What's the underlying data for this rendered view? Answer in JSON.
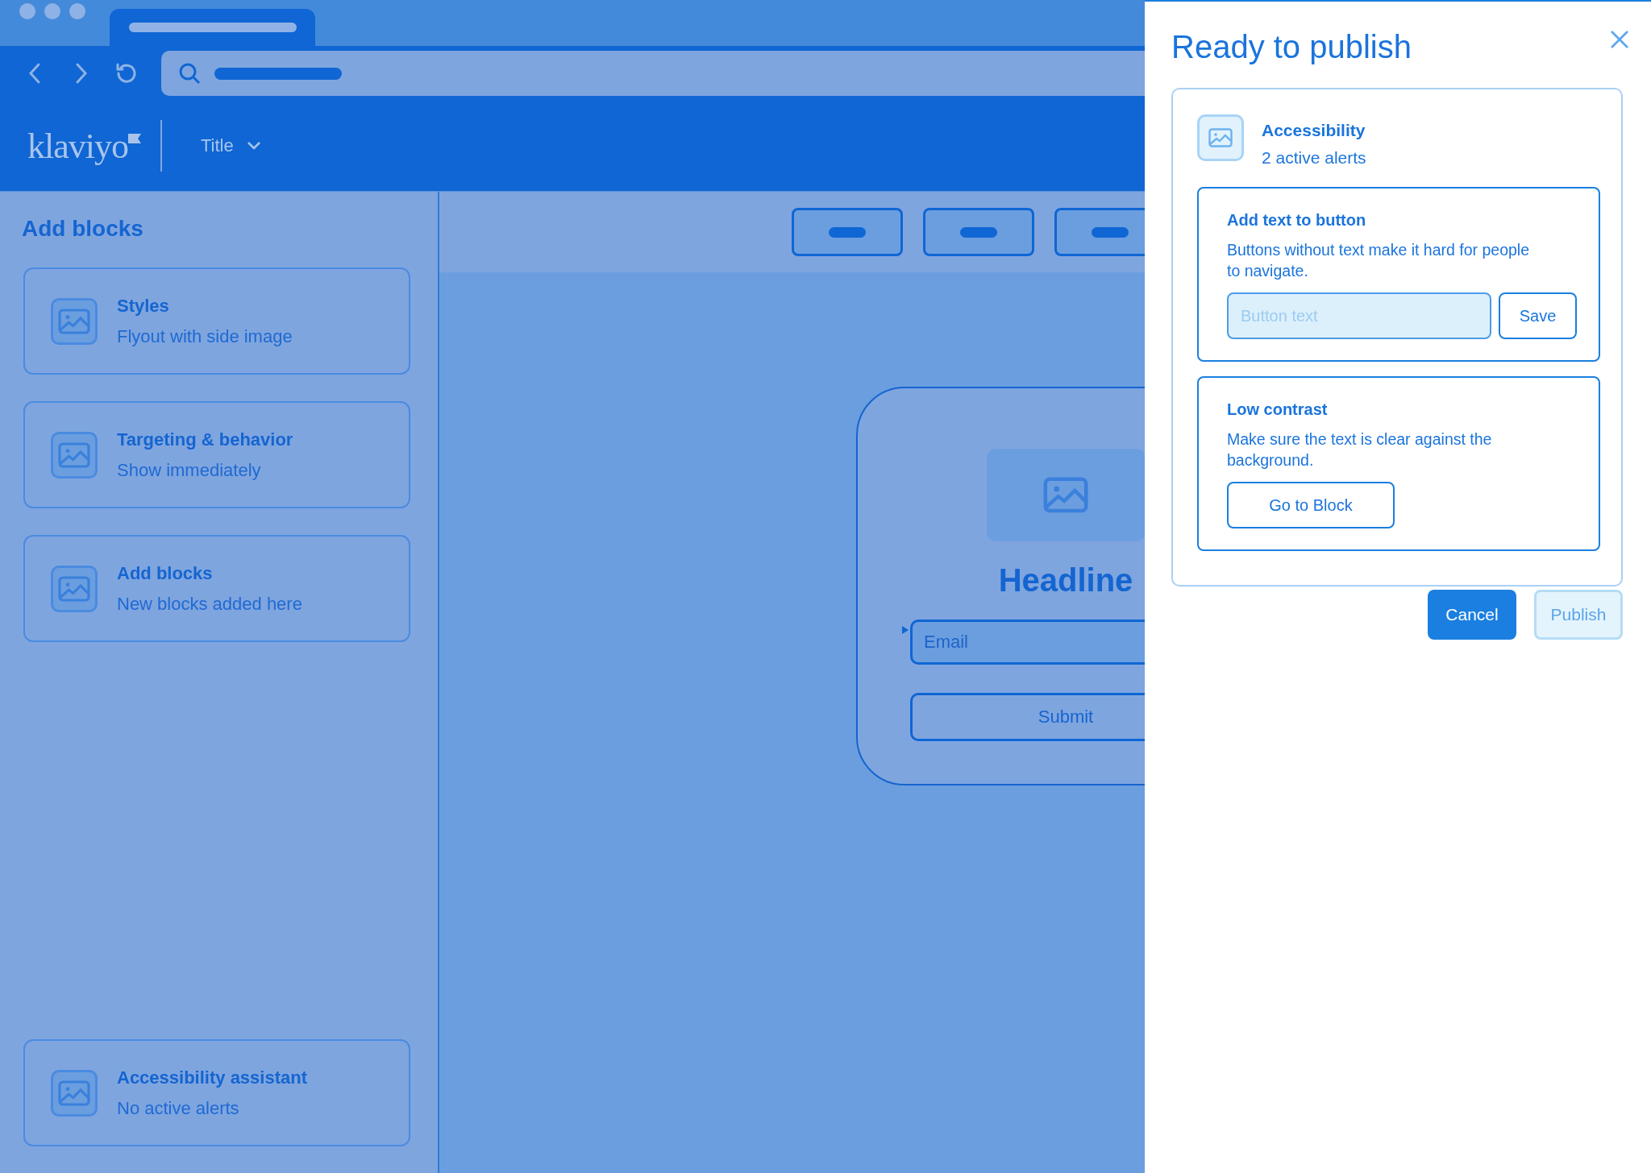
{
  "app_header": {
    "logo": "klaviyo",
    "title_menu": "Title"
  },
  "sidebar": {
    "title": "Add blocks",
    "items": [
      {
        "title": "Styles",
        "subtitle": "Flyout with side image"
      },
      {
        "title": "Targeting & behavior",
        "subtitle": "Show immediately"
      },
      {
        "title": "Add blocks",
        "subtitle": "New blocks added here"
      }
    ],
    "footer_item": {
      "title": "Accessibility assistant",
      "subtitle": "No active alerts"
    }
  },
  "canvas": {
    "form": {
      "headline": "Headline",
      "email_placeholder": "Email",
      "submit": "Submit"
    }
  },
  "publish_panel": {
    "title": "Ready to publish",
    "summary": {
      "title": "Accessibility",
      "subtitle": "2 active alerts"
    },
    "alerts": [
      {
        "kind": "input",
        "title": "Add text to button",
        "description": "Buttons without text make it hard for people to navigate.",
        "placeholder": "Button text",
        "action": "Save"
      },
      {
        "kind": "button",
        "title": "Low contrast",
        "description": "Make sure the text is clear against the background.",
        "action": "Go to Block"
      }
    ],
    "buttons": [
      {
        "label": "Cancel",
        "disabled": false
      },
      {
        "label": "Publish",
        "disabled": true
      }
    ]
  }
}
